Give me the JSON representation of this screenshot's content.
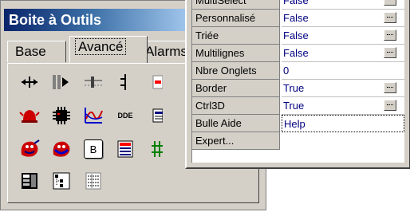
{
  "toolbox": {
    "title": "Boite à Outils",
    "tabs": [
      {
        "label": "Base",
        "active": false
      },
      {
        "label": "Avancé",
        "active": true
      },
      {
        "label": "Alarms",
        "active": false
      }
    ],
    "tools": [
      {
        "icon": "move-horizontal-icon"
      },
      {
        "icon": "pan-bars-icon"
      },
      {
        "icon": "slider-icon"
      },
      {
        "icon": "stepper-icon"
      },
      {
        "icon": "grid-partial-icon"
      },
      {
        "icon": "alarm-bell-icon"
      },
      {
        "icon": "chip-icon"
      },
      {
        "icon": "trend-chart-icon"
      },
      {
        "icon": "dde-icon",
        "text": "DDE"
      },
      {
        "icon": "list-partial-icon"
      },
      {
        "icon": "mascot-red-icon"
      },
      {
        "icon": "mascot-blue-icon"
      },
      {
        "icon": "b-button-icon",
        "text": "B"
      },
      {
        "icon": "list-box-icon"
      },
      {
        "icon": "grid-green-icon"
      },
      {
        "icon": "table-dark-icon"
      },
      {
        "icon": "tree-view-icon"
      },
      {
        "icon": "report-list-icon"
      }
    ]
  },
  "properties": {
    "rows": [
      {
        "label": "MultiSelect",
        "value": "False",
        "ellipsis": true
      },
      {
        "label": "Personnalisé",
        "value": "False",
        "ellipsis": true
      },
      {
        "label": "Triée",
        "value": "False",
        "ellipsis": true
      },
      {
        "label": "Multilignes",
        "value": "False",
        "ellipsis": true
      },
      {
        "label": "Nbre Onglets",
        "value": "0",
        "ellipsis": false
      },
      {
        "label": "Border",
        "value": "True",
        "ellipsis": true
      },
      {
        "label": "Ctrl3D",
        "value": "True",
        "ellipsis": true
      },
      {
        "label": "Bulle Aide",
        "value": "Help",
        "ellipsis": false,
        "focused": true
      },
      {
        "label": "Expert...",
        "value": "",
        "ellipsis": false
      }
    ]
  }
}
